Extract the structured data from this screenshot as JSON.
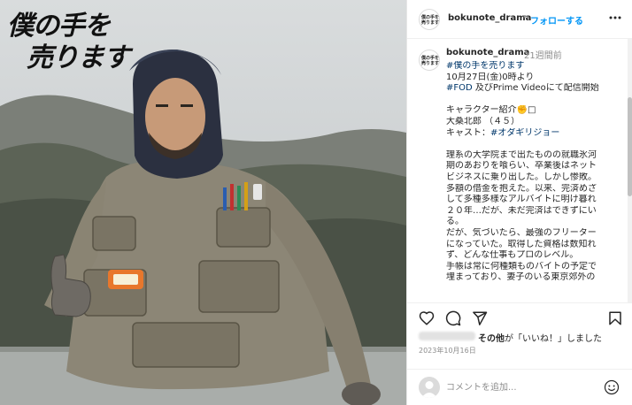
{
  "photo": {
    "title_line1": "僕の手を",
    "title_line2": "売ります"
  },
  "header": {
    "avatar_text_line1": "僕の手を",
    "avatar_text_line2": "売ります",
    "username": "bokunote_drama",
    "separator": "•",
    "follow_label": "フォローする",
    "more_icon": "more-horizontal-icon"
  },
  "caption": {
    "username": "bokunote_drama",
    "time": "21週間前",
    "lines": [
      "#僕の手を売ります",
      "10月27日(金)0時より",
      "#FOD 及びPrime Videoにて配信開始",
      "",
      "キャラクター紹介✊□",
      "大桑北郎 （４５）",
      "キャスト：#オダギリジョー",
      "",
      "理系の大学院まで出たものの就職氷河",
      "期のあおりを喰らい、卒業後はネット",
      "ビジネスに乗り出した。しかし惨敗。",
      "多額の借金を抱えた。以来、完済めざ",
      "して多種多様なアルバイトに明け暮れ",
      "２０年…だが、未だ完済はできずにい",
      "る。",
      "だが、気づいたら、最強のフリーター",
      "になっていた。取得した資格は数知れ",
      "ず、どんな仕事もプロのレベル。",
      "手帳は常に何種類ものバイトの予定で",
      "埋まっており、妻子のいる東京郊外の"
    ]
  },
  "actions": {
    "like_icon": "heart-icon",
    "comment_icon": "comment-icon",
    "share_icon": "send-icon",
    "save_icon": "bookmark-icon"
  },
  "likes": {
    "others_label": "その他",
    "suffix": "が「いいね！」しました"
  },
  "date": "2023年10月16日",
  "comment_box": {
    "placeholder": "コメントを追加...",
    "emoji_icon": "emoji-icon"
  },
  "colors": {
    "accent": "#0095f6",
    "hashtag": "#00376b",
    "muted": "#8e8e8e",
    "text": "#262626"
  }
}
